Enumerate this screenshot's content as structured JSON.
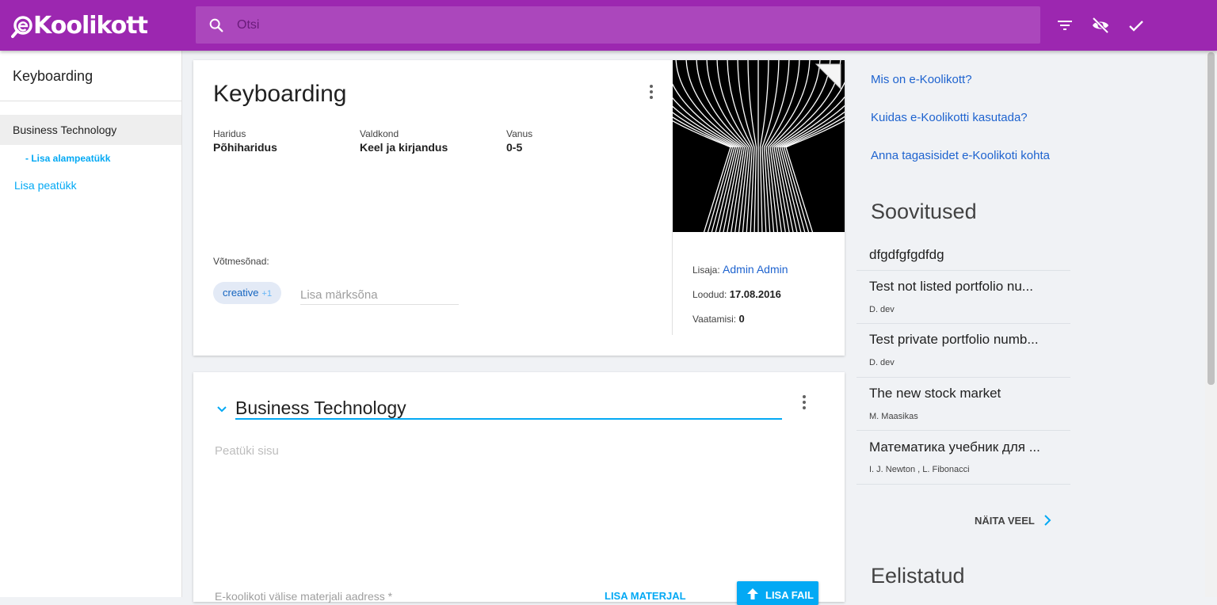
{
  "header": {
    "logo_text": "Koolikott",
    "search_placeholder": "Otsi",
    "icons": [
      "search-icon",
      "filter-icon",
      "visibility-off-icon",
      "check-icon"
    ]
  },
  "sidebar": {
    "title": "Keyboarding",
    "chapter": "Business Technology",
    "add_subchapter": "- Lisa alampeatükk",
    "add_chapter": "Lisa peatükk"
  },
  "portfolio": {
    "title": "Keyboarding",
    "education_label": "Haridus",
    "education_value": "Põhiharidus",
    "domain_label": "Valdkond",
    "domain_value": "Keel ja kirjandus",
    "age_label": "Vanus",
    "age_value": "0-5",
    "keywords_label": "Võtmesõnad:",
    "tag": "creative",
    "tag_more": "+1",
    "keyword_placeholder": "Lisa märksõna",
    "creator_label": "Lisaja:",
    "creator_value": "Admin Admin",
    "created_label": "Loodud:",
    "created_value": "17.08.2016",
    "views_label": "Vaatamisi:",
    "views_value": "0"
  },
  "chapter_card": {
    "title": "Business Technology",
    "content_placeholder": "Peatüki sisu",
    "external_label": "E-koolikoti välise materjali aadress *",
    "add_material": "LISA MATERJAL",
    "add_file": "LISA FAIL"
  },
  "right": {
    "links": [
      "Mis on e-Koolikott?",
      "Kuidas e-Koolikotti kasutada?",
      "Anna tagasisidet e-Koolikoti kohta"
    ],
    "recommendations_title": "Soovitused",
    "recommendations": [
      {
        "title": "dfgdfgfgdfdg",
        "author": ""
      },
      {
        "title": "Test not listed portfolio nu...",
        "author": "D. dev"
      },
      {
        "title": "Test private portfolio numb...",
        "author": "D. dev"
      },
      {
        "title": "The new stock market",
        "author": "M. Maasikas"
      },
      {
        "title": "Математика учебник для ...",
        "author": "I. J. Newton , L. Fibonacci"
      }
    ],
    "show_more": "NÄITA VEEL",
    "favorites_title": "Eelistatud"
  },
  "colors": {
    "header": "#9c27b0",
    "search": "#ab47bc",
    "accent": "#03a9f4",
    "link": "#1e63cf"
  }
}
